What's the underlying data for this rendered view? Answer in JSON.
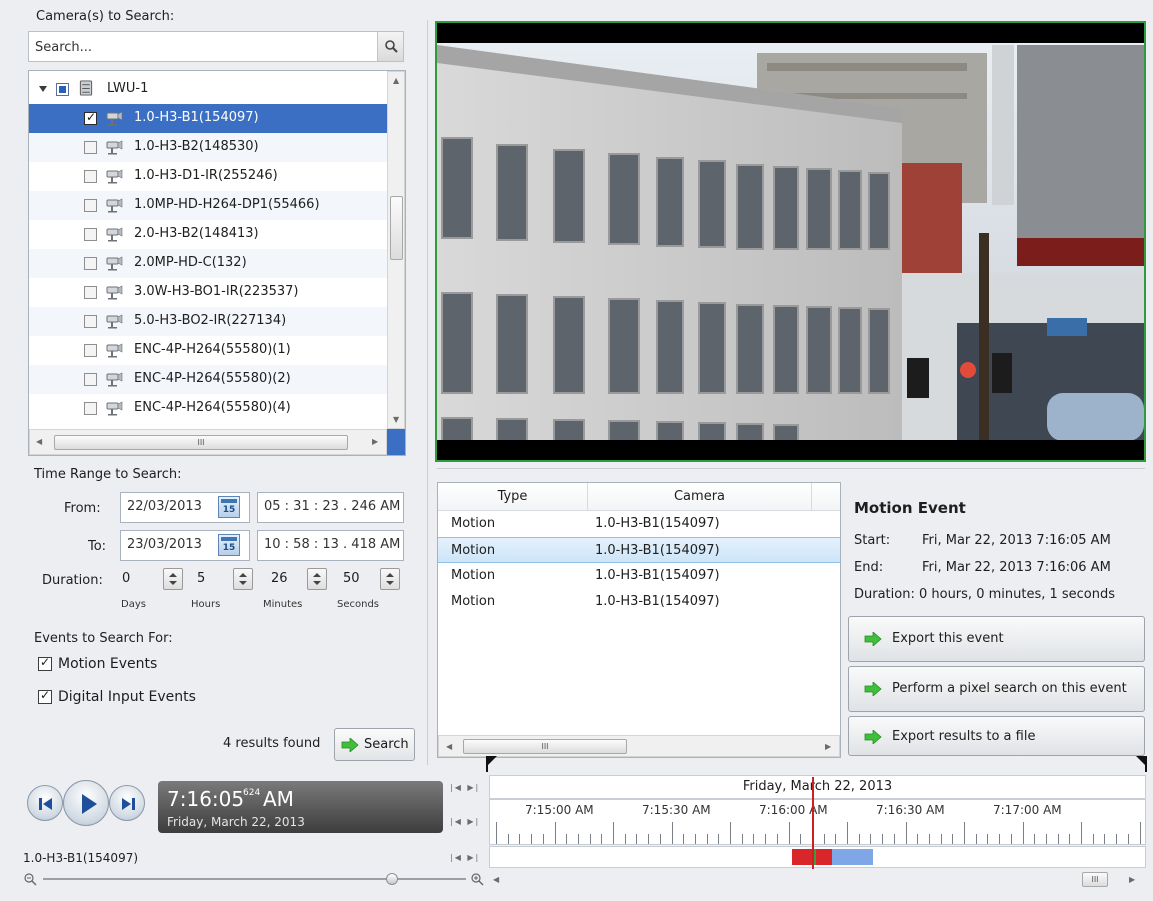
{
  "cameras": {
    "heading": "Camera(s) to Search:",
    "search_placeholder": "Search...",
    "root_label": "LWU-1",
    "items": [
      {
        "label": "1.0-H3-B1(154097)",
        "checked": true
      },
      {
        "label": "1.0-H3-B2(148530)",
        "checked": false
      },
      {
        "label": "1.0-H3-D1-IR(255246)",
        "checked": false
      },
      {
        "label": "1.0MP-HD-H264-DP1(55466)",
        "checked": false
      },
      {
        "label": "2.0-H3-B2(148413)",
        "checked": false
      },
      {
        "label": "2.0MP-HD-C(132)",
        "checked": false
      },
      {
        "label": "3.0W-H3-BO1-IR(223537)",
        "checked": false
      },
      {
        "label": "5.0-H3-BO2-IR(227134)",
        "checked": false
      },
      {
        "label": "ENC-4P-H264(55580)(1)",
        "checked": false
      },
      {
        "label": "ENC-4P-H264(55580)(2)",
        "checked": false
      },
      {
        "label": "ENC-4P-H264(55580)(4)",
        "checked": false
      }
    ],
    "hscroll_grip": "III"
  },
  "time_range": {
    "heading": "Time Range to Search:",
    "from_label": "From:",
    "from_date": "22/03/2013",
    "from_time": "05 : 31 : 23 . 246  AM",
    "to_label": "To:",
    "to_date": "23/03/2013",
    "to_time": "10 : 58 : 13 . 418  AM",
    "calendar_day": "15",
    "duration_label": "Duration:",
    "duration": {
      "days": "0",
      "hours": "5",
      "minutes": "26",
      "seconds": "50"
    },
    "units": {
      "days": "Days",
      "hours": "Hours",
      "minutes": "Minutes",
      "seconds": "Seconds"
    }
  },
  "events": {
    "heading": "Events to Search For:",
    "motion_label": "Motion Events",
    "digital_label": "Digital Input Events",
    "motion_checked": true,
    "digital_checked": true
  },
  "search": {
    "results_text": "4 results found",
    "button_label": "Search"
  },
  "results_table": {
    "columns": [
      "Type",
      "Camera"
    ],
    "rows": [
      {
        "type": "Motion",
        "camera": "1.0-H3-B1(154097)"
      },
      {
        "type": "Motion",
        "camera": "1.0-H3-B1(154097)"
      },
      {
        "type": "Motion",
        "camera": "1.0-H3-B1(154097)"
      },
      {
        "type": "Motion",
        "camera": "1.0-H3-B1(154097)"
      }
    ],
    "selected_index": 1,
    "hscroll_grip": "III"
  },
  "motion_event": {
    "title": "Motion Event",
    "start_label": "Start:",
    "start_value": "Fri, Mar 22, 2013 7:16:05 AM",
    "end_label": "End:",
    "end_value": "Fri, Mar 22, 2013 7:16:06 AM",
    "duration_text": "Duration: 0 hours, 0 minutes, 1 seconds",
    "buttons": {
      "export_event": "Export this event",
      "pixel_search": "Perform a pixel search on this event",
      "export_results": "Export results to a file"
    }
  },
  "player": {
    "time_main": "7:16:05",
    "time_ms": "624",
    "time_ampm": "AM",
    "date": "Friday, March 22, 2013",
    "camera_name": "1.0-H3-B1(154097)"
  },
  "timeline": {
    "date_label": "Friday, March 22, 2013",
    "ticks": [
      "7:15:00 AM",
      "7:15:30 AM",
      "7:16:00 AM",
      "7:16:30 AM",
      "7:17:00 AM"
    ],
    "grip": "III"
  },
  "colors": {
    "selection": "#3a6fc4",
    "video_border": "#2e9b3c",
    "motion_red": "#d8262a",
    "recording_blue": "#7fa6e6",
    "export_arrow": "#3fbf3a"
  }
}
